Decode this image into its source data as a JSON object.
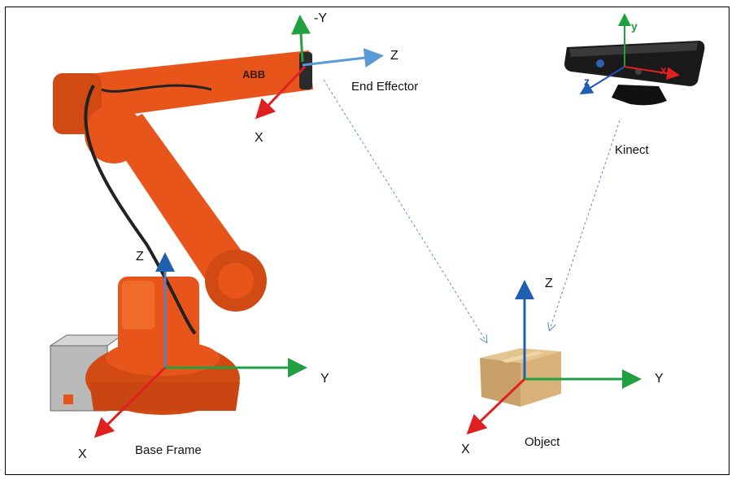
{
  "labels": {
    "end_effector": "End Effector",
    "kinect": "Kinect",
    "base_frame": "Base Frame",
    "object": "Object"
  },
  "robot_logo": "ABB",
  "axes": {
    "end_effector": {
      "up": "-Y",
      "right": "Z",
      "down": "X"
    },
    "base": {
      "up": "Z",
      "right": "Y",
      "down": "X"
    },
    "object": {
      "up": "Z",
      "right": "Y",
      "down": "X"
    },
    "kinect": {
      "up": "y",
      "right": "x",
      "left": "z"
    }
  },
  "colors": {
    "x_axis": "#e02020",
    "y_axis": "#20a040",
    "z_axis": "#1f5fb0",
    "ee_z_axis": "#5b9bd5",
    "robot_orange": "#e8551a",
    "dashed_line": "#5b8fd0"
  }
}
